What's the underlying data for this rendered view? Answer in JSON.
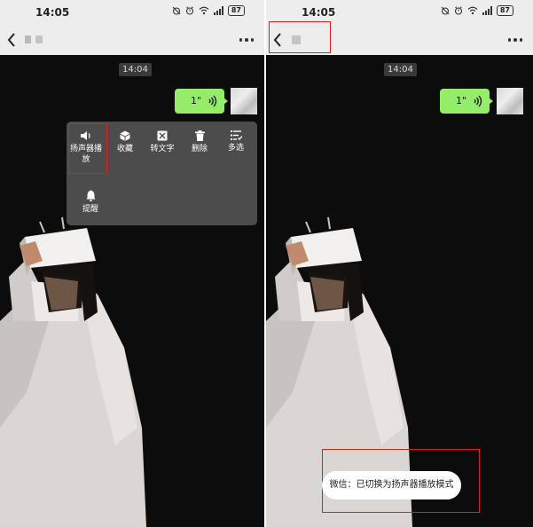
{
  "status": {
    "time": "14:05",
    "battery": "87"
  },
  "chat": {
    "timestamp": "14:04",
    "voice_duration": "1\""
  },
  "menu": {
    "items": [
      {
        "label": "扬声器播放",
        "icon": "speaker-icon"
      },
      {
        "label": "收藏",
        "icon": "cube-icon"
      },
      {
        "label": "转文字",
        "icon": "text-convert-icon"
      },
      {
        "label": "删除",
        "icon": "trash-icon"
      },
      {
        "label": "多选",
        "icon": "multiselect-icon"
      },
      {
        "label": "提醒",
        "icon": "bell-icon"
      }
    ]
  },
  "toast": {
    "message": "微信：已切换为扬声器播放模式"
  },
  "colors": {
    "bubble": "#95ec69",
    "highlight": "#e02020",
    "menu": "#4c4c4c"
  }
}
